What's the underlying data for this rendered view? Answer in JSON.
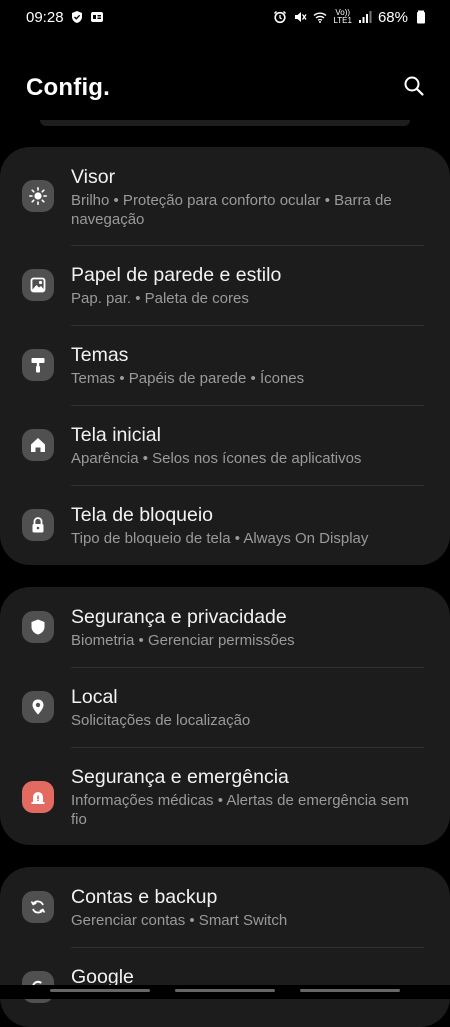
{
  "status_bar": {
    "time": "09:28",
    "battery_text": "68%",
    "volte_top": "Vo))",
    "volte_bottom": "LTE1"
  },
  "header": {
    "title": "Config."
  },
  "groups": [
    {
      "items": [
        {
          "label": "Visor",
          "sub": "Brilho  •  Proteção para conforto ocular  •  Barra de navegação",
          "icon": "sun-icon"
        },
        {
          "label": "Papel de parede e estilo",
          "sub": "Pap. par.  •  Paleta de cores",
          "icon": "image-icon"
        },
        {
          "label": "Temas",
          "sub": "Temas  •  Papéis de parede  •  Ícones",
          "icon": "paint-roller-icon"
        },
        {
          "label": "Tela inicial",
          "sub": "Aparência  •  Selos nos ícones de aplicativos",
          "icon": "home-icon"
        },
        {
          "label": "Tela de bloqueio",
          "sub": "Tipo de bloqueio de tela  •  Always On Display",
          "icon": "lock-icon"
        }
      ]
    },
    {
      "items": [
        {
          "label": "Segurança e privacidade",
          "sub": "Biometria  •  Gerenciar permissões",
          "icon": "shield-icon"
        },
        {
          "label": "Local",
          "sub": "Solicitações de localização",
          "icon": "location-pin-icon"
        },
        {
          "label": "Segurança e emergência",
          "sub": "Informações médicas  •  Alertas de emergência sem fio",
          "icon": "emergency-icon"
        }
      ]
    },
    {
      "items": [
        {
          "label": "Contas e backup",
          "sub": "Gerenciar contas  •  Smart Switch",
          "icon": "sync-icon"
        },
        {
          "label": "Google",
          "sub": "",
          "icon": "google-icon"
        }
      ]
    }
  ],
  "colors": {
    "background": "#000000",
    "card": "#1c1c1c",
    "icon_bg": "#505050",
    "emergency_icon_bg": "#e26a61",
    "subtext": "#9a9a9a"
  }
}
